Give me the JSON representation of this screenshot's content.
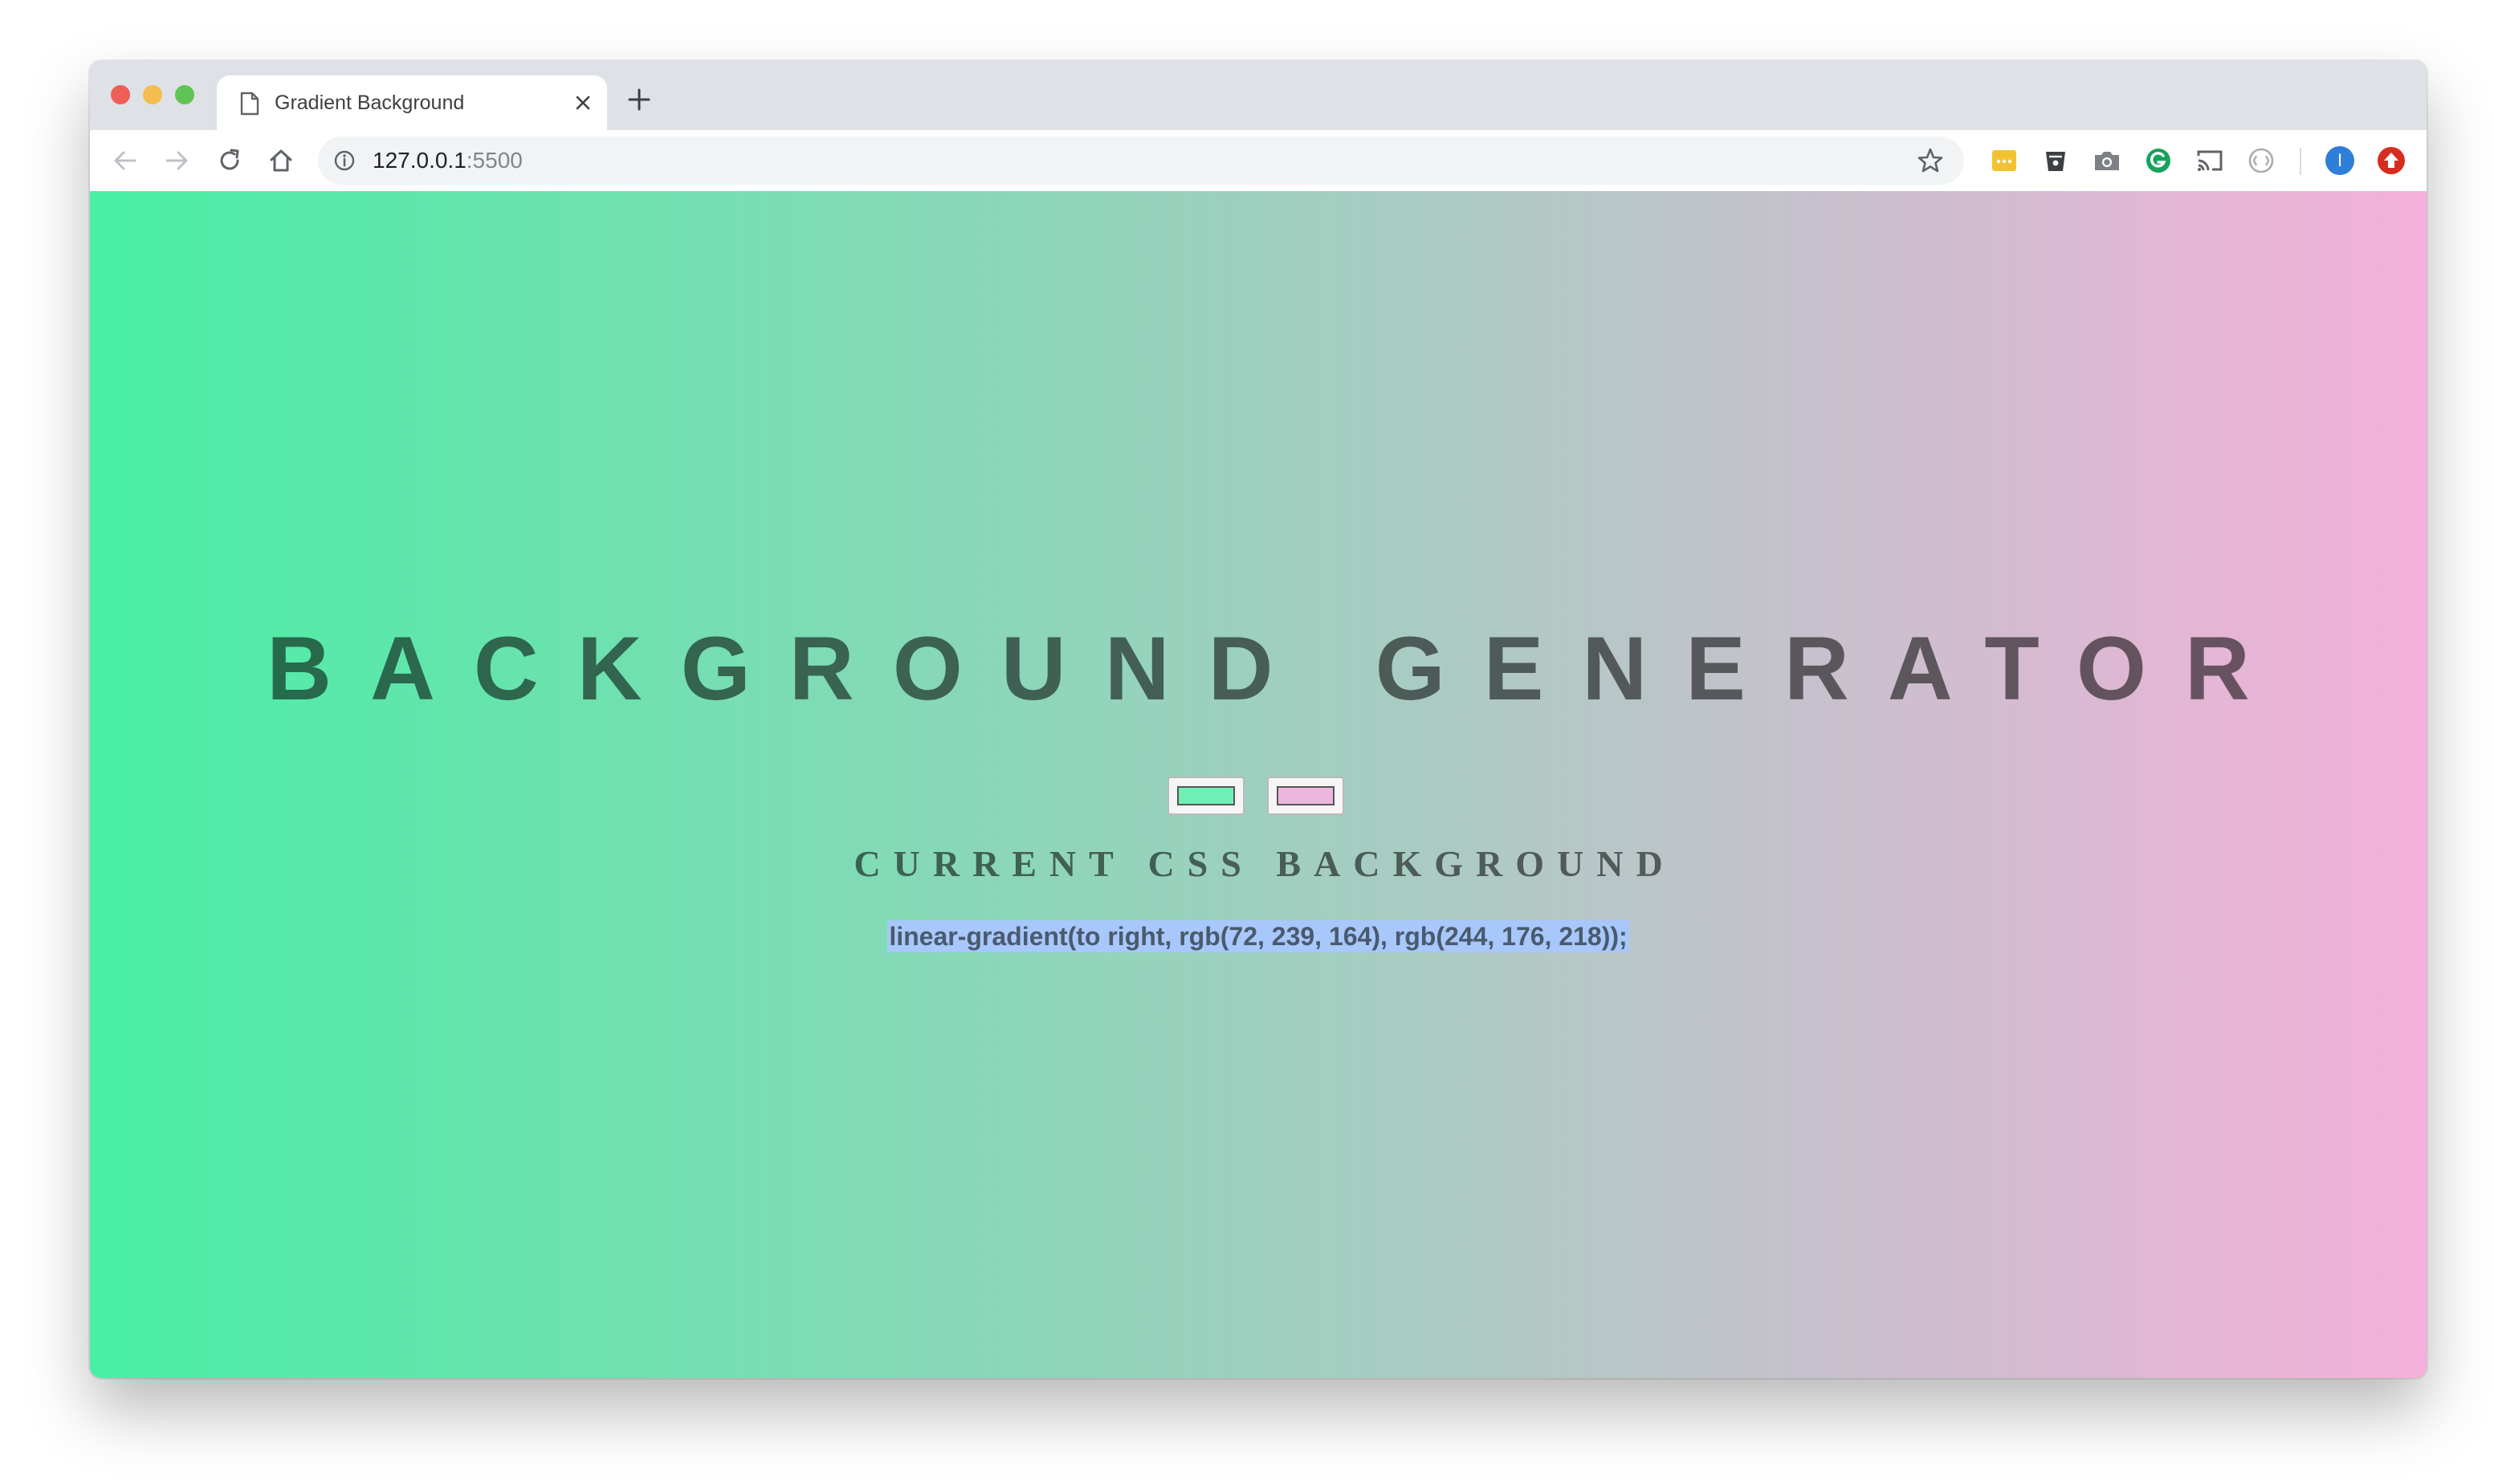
{
  "browser": {
    "tab_title": "Gradient Background",
    "url_host": "127.0.0.1",
    "url_port": ":5500",
    "extensions": [
      "extension-yellow-icon",
      "extension-cup-icon",
      "camera-icon",
      "grammarly-icon",
      "cast-icon",
      "extension-circle-icon",
      "profile-avatar-icon",
      "extension-red-icon"
    ],
    "profile_initial": "I"
  },
  "page": {
    "heading": "BACKGROUND GENERATOR",
    "subheading": "CURRENT CSS BACKGROUND",
    "css_output": "linear-gradient(to right, rgb(72, 239, 164), rgb(244, 176, 218));",
    "color1": "#48efa4",
    "color2": "#f4b0da"
  },
  "colors": {
    "gradient_start": "#48efa4",
    "gradient_end": "#f4b0da",
    "selection_highlight": "#a8c7fa"
  }
}
